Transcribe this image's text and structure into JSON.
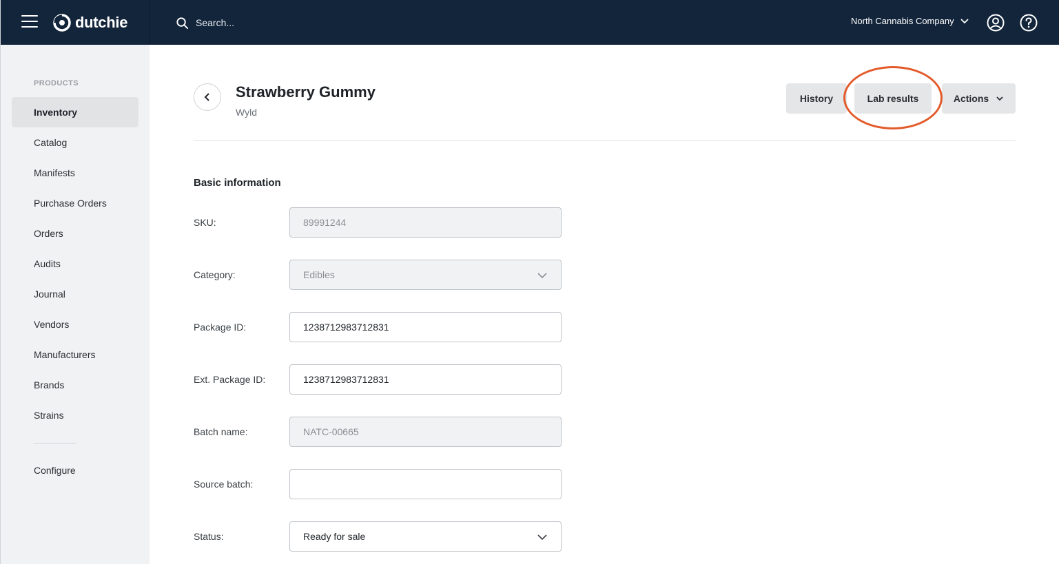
{
  "topbar": {
    "brand": "dutchie",
    "search_placeholder": "Search...",
    "company": "North Cannabis Company",
    "bg_color": "#13253b"
  },
  "sidebar": {
    "heading": "PRODUCTS",
    "items": [
      {
        "label": "Inventory",
        "active": true
      },
      {
        "label": "Catalog"
      },
      {
        "label": "Manifests"
      },
      {
        "label": "Purchase Orders"
      },
      {
        "label": "Orders"
      },
      {
        "label": "Audits"
      },
      {
        "label": "Journal"
      },
      {
        "label": "Vendors"
      },
      {
        "label": "Manufacturers"
      },
      {
        "label": "Brands"
      },
      {
        "label": "Strains"
      }
    ],
    "configure": "Configure"
  },
  "header": {
    "title": "Strawberry Gummy",
    "subtitle": "Wyld",
    "buttons": {
      "history": "History",
      "lab_results": "Lab results",
      "actions": "Actions"
    },
    "highlight_color": "#e35b2b"
  },
  "basic_info": {
    "title": "Basic information",
    "fields": {
      "sku": {
        "label": "SKU:",
        "value": "89991244"
      },
      "category": {
        "label": "Category:",
        "value": "Edibles"
      },
      "package_id": {
        "label": "Package ID:",
        "value": "1238712983712831"
      },
      "ext_package_id": {
        "label": "Ext. Package ID:",
        "value": "1238712983712831"
      },
      "batch_name": {
        "label": "Batch name:",
        "value": "NATC-00665"
      },
      "source_batch": {
        "label": "Source batch:",
        "value": ""
      },
      "status": {
        "label": "Status:",
        "value": "Ready for sale"
      }
    }
  }
}
